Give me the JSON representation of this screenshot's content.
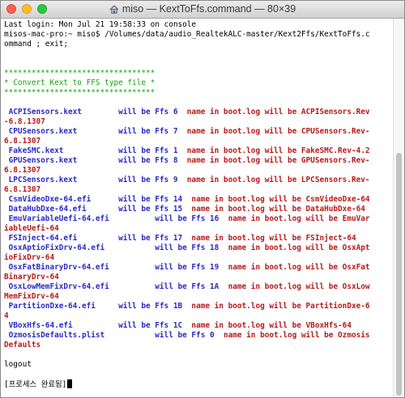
{
  "window": {
    "title": "miso — KextToFfs.command — 80×39",
    "icon": "home-folder-icon"
  },
  "terminal": {
    "lines": [
      [
        {
          "t": "Last login: Mon Jul 21 19:58:33 on console",
          "c": "black"
        }
      ],
      [
        {
          "t": "misos-mac-pro:~ miso$ /Volumes/data/audio_RealtekALC-master/Kext2Ffs/KextToFfs.c",
          "c": "black"
        }
      ],
      [
        {
          "t": "ommand ; exit;",
          "c": "black"
        }
      ],
      [],
      [],
      [
        {
          "t": "*********************************",
          "c": "green"
        }
      ],
      [
        {
          "t": "* Convert Kext to FFS type file *",
          "c": "green"
        }
      ],
      [
        {
          "t": "*********************************",
          "c": "green"
        }
      ],
      [],
      [
        {
          "t": " ACPISensors.kext        will be Ffs 6  ",
          "c": "blue"
        },
        {
          "t": "name in boot.log will be ACPISensors.Rev",
          "c": "red"
        }
      ],
      [
        {
          "t": "-6.8.1307",
          "c": "red"
        }
      ],
      [
        {
          "t": " CPUSensors.kext         will be Ffs 7  ",
          "c": "blue"
        },
        {
          "t": "name in boot.log will be CPUSensors.Rev-",
          "c": "red"
        }
      ],
      [
        {
          "t": "6.8.1307",
          "c": "red"
        }
      ],
      [
        {
          "t": " FakeSMC.kext            will be Ffs 1  ",
          "c": "blue"
        },
        {
          "t": "name in boot.log will be FakeSMC.Rev-4.2",
          "c": "red"
        }
      ],
      [
        {
          "t": " GPUSensors.kext         will be Ffs 8  ",
          "c": "blue"
        },
        {
          "t": "name in boot.log will be GPUSensors.Rev-",
          "c": "red"
        }
      ],
      [
        {
          "t": "6.8.1307",
          "c": "red"
        }
      ],
      [
        {
          "t": " LPCSensors.kext         will be Ffs 9  ",
          "c": "blue"
        },
        {
          "t": "name in boot.log will be LPCSensors.Rev-",
          "c": "red"
        }
      ],
      [
        {
          "t": "6.8.1307",
          "c": "red"
        }
      ],
      [
        {
          "t": " CsmVideoDxe-64.efi      will be Ffs 14  ",
          "c": "blue"
        },
        {
          "t": "name in boot.log will be CsmVideoDxe-64",
          "c": "red"
        }
      ],
      [
        {
          "t": " DataHubDxe-64.efi       will be Ffs 15  ",
          "c": "blue"
        },
        {
          "t": "name in boot.log will be DataHubDxe-64",
          "c": "red"
        }
      ],
      [
        {
          "t": " EmuVariableUefi-64.efi          will be Ffs 16  ",
          "c": "blue"
        },
        {
          "t": "name in boot.log will be EmuVar",
          "c": "red"
        }
      ],
      [
        {
          "t": "iableUefi-64",
          "c": "red"
        }
      ],
      [
        {
          "t": " FSInject-64.efi         will be Ffs 17  ",
          "c": "blue"
        },
        {
          "t": "name in boot.log will be FSInject-64",
          "c": "red"
        }
      ],
      [
        {
          "t": " OsxAptioFixDrv-64.efi           will be Ffs 18  ",
          "c": "blue"
        },
        {
          "t": "name in boot.log will be OsxApt",
          "c": "red"
        }
      ],
      [
        {
          "t": "ioFixDrv-64",
          "c": "red"
        }
      ],
      [
        {
          "t": " OsxFatBinaryDrv-64.efi          will be Ffs 19  ",
          "c": "blue"
        },
        {
          "t": "name in boot.log will be OsxFat",
          "c": "red"
        }
      ],
      [
        {
          "t": "BinaryDrv-64",
          "c": "red"
        }
      ],
      [
        {
          "t": " OsxLowMemFixDrv-64.efi          will be Ffs 1A  ",
          "c": "blue"
        },
        {
          "t": "name in boot.log will be OsxLow",
          "c": "red"
        }
      ],
      [
        {
          "t": "MemFixDrv-64",
          "c": "red"
        }
      ],
      [
        {
          "t": " PartitionDxe-64.efi     will be Ffs 1B  ",
          "c": "blue"
        },
        {
          "t": "name in boot.log will be PartitionDxe-6",
          "c": "red"
        }
      ],
      [
        {
          "t": "4",
          "c": "red"
        }
      ],
      [
        {
          "t": " VBoxHfs-64.efi          will be Ffs 1C  ",
          "c": "blue"
        },
        {
          "t": "name in boot.log will be VBoxHfs-64",
          "c": "red"
        }
      ],
      [
        {
          "t": " OzmosisDefaults.plist           will be Ffs 0  ",
          "c": "blue"
        },
        {
          "t": "name in boot.log will be Ozmosis",
          "c": "red"
        }
      ],
      [
        {
          "t": "Defaults",
          "c": "red"
        }
      ],
      [],
      [
        {
          "t": "logout",
          "c": "black"
        }
      ],
      [],
      [
        {
          "t": "[프로세스 완료됨]",
          "c": "black"
        }
      ]
    ]
  }
}
